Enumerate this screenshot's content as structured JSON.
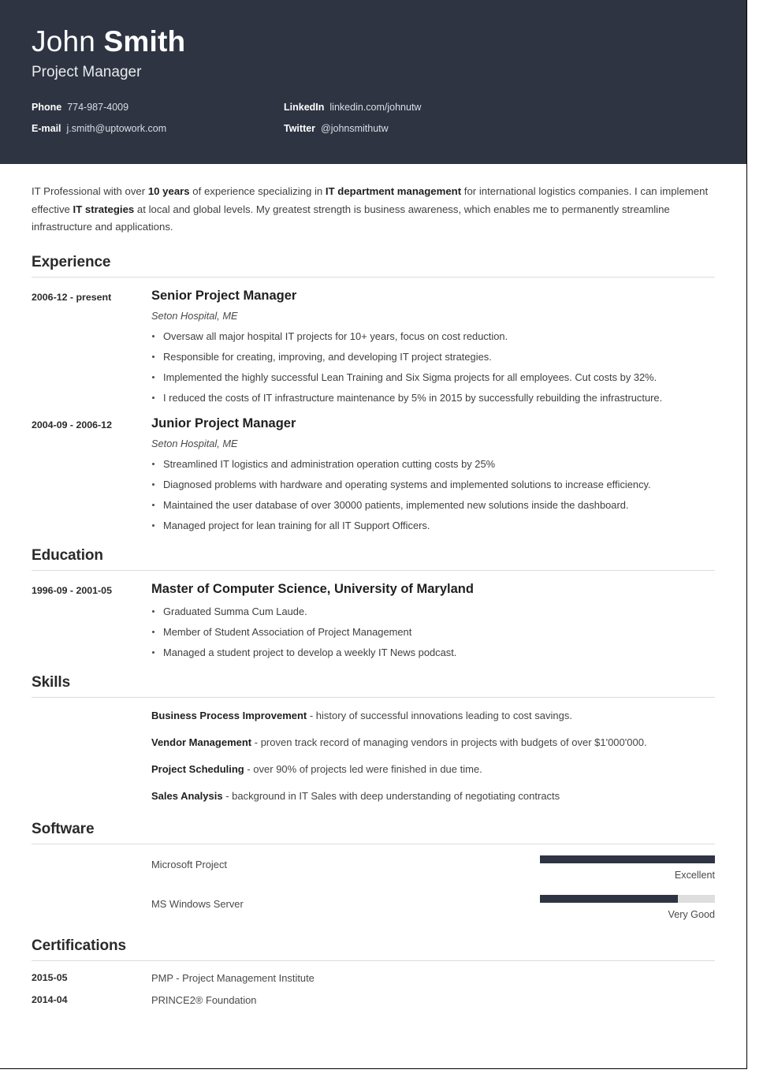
{
  "theme": {
    "header_bg": "#2e3442",
    "accent": "#2e3442",
    "track": "#dedede",
    "rule": "#dcdcdc"
  },
  "header": {
    "first_name": "John ",
    "last_name": "Smith",
    "job_title": "Project Manager",
    "contacts": [
      {
        "label": "Phone",
        "value": "774-987-4009"
      },
      {
        "label": "LinkedIn",
        "value": "linkedin.com/johnutw"
      },
      {
        "label": "E-mail",
        "value": "j.smith@uptowork.com"
      },
      {
        "label": "Twitter",
        "value": "@johnsmithutw"
      }
    ]
  },
  "summary": {
    "part1": "IT Professional with over ",
    "bold1": "10 years",
    "part2": " of experience specializing in ",
    "bold2": "IT department management",
    "part3": " for international logistics companies. I can implement effective ",
    "bold3": "IT strategies",
    "part4": " at local and global levels. My greatest strength is business awareness, which enables me to permanently streamline infrastructure and applications."
  },
  "sections": {
    "experience_title": "Experience",
    "education_title": "Education",
    "skills_title": "Skills",
    "software_title": "Software",
    "certifications_title": "Certifications"
  },
  "experience": [
    {
      "date": "2006-12 - present",
      "role": "Senior Project Manager",
      "company": "Seton Hospital, ME",
      "bullets": [
        "Oversaw all major hospital IT projects for 10+ years, focus on cost reduction.",
        "Responsible for creating, improving, and developing IT project strategies.",
        "Implemented the highly successful Lean Training and Six Sigma projects for all employees. Cut costs by 32%.",
        "I reduced the costs of IT infrastructure maintenance by 5% in 2015 by successfully rebuilding the infrastructure."
      ]
    },
    {
      "date": "2004-09 - 2006-12",
      "role": "Junior Project Manager",
      "company": "Seton Hospital, ME",
      "bullets": [
        "Streamlined IT logistics and administration operation cutting costs by 25%",
        "Diagnosed problems with hardware and operating systems and implemented solutions to increase efficiency.",
        "Maintained the user database of over 30000 patients, implemented new solutions inside the dashboard.",
        "Managed project for lean training for all IT Support Officers."
      ]
    }
  ],
  "education": [
    {
      "date": "1996-09 - 2001-05",
      "degree": "Master of Computer Science, University of Maryland",
      "bullets": [
        "Graduated Summa Cum Laude.",
        "Member of Student Association of Project Management",
        "Managed a student project to develop a weekly IT News podcast."
      ]
    }
  ],
  "skills": [
    {
      "name": "Business Process Improvement",
      "description": " - history of successful innovations leading to cost savings."
    },
    {
      "name": "Vendor Management",
      "description": " - proven track record of managing vendors in projects with budgets of over $1'000'000."
    },
    {
      "name": "Project Scheduling",
      "description": " - over 90% of projects led were finished in due time."
    },
    {
      "name": "Sales Analysis",
      "description": " - background in IT Sales with deep understanding of negotiating contracts"
    }
  ],
  "software": [
    {
      "name": "Microsoft Project",
      "level": "Excellent",
      "percent": 100
    },
    {
      "name": "MS Windows Server",
      "level": "Very Good",
      "percent": 79
    }
  ],
  "certifications": [
    {
      "date": "2015-05",
      "name": "PMP - Project Management Institute"
    },
    {
      "date": "2014-04",
      "name": "PRINCE2® Foundation"
    }
  ]
}
